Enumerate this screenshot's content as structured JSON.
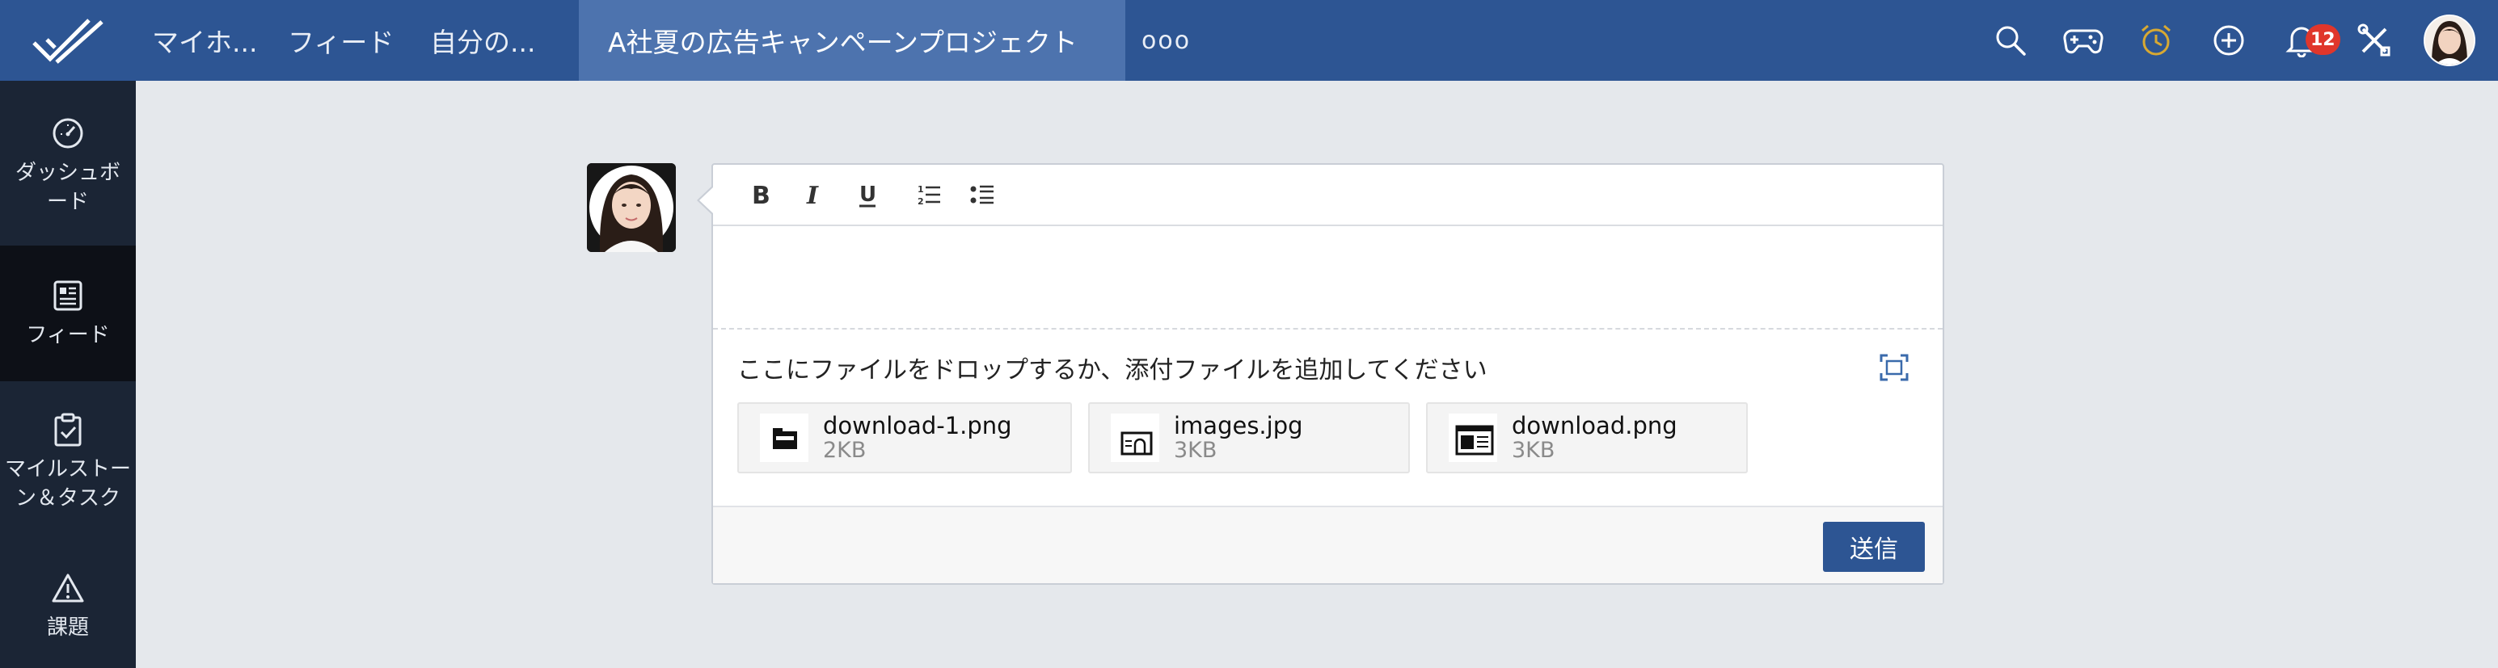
{
  "topbar": {
    "tabs": [
      {
        "label": "マイホ..."
      },
      {
        "label": "フィード"
      },
      {
        "label": "自分の..."
      },
      {
        "label": "A社夏の広告キャンペーンプロジェクト"
      }
    ],
    "more_label": "ooo",
    "notification_count": "12",
    "icons": [
      "search-icon",
      "game-controller-icon",
      "alarm-clock-icon",
      "add-icon",
      "bell-icon",
      "tools-icon"
    ]
  },
  "sidebar": {
    "items": [
      {
        "label": "ダッシュボード",
        "icon": "dashboard-gauge-icon"
      },
      {
        "label": "フィード",
        "icon": "feed-icon"
      },
      {
        "label": "マイルストーン＆タスク",
        "icon": "clipboard-check-icon"
      },
      {
        "label": "課題",
        "icon": "warning-icon"
      }
    ]
  },
  "composer": {
    "toolbar": [
      "B",
      "I",
      "U",
      "ordered-list",
      "bullet-list"
    ],
    "editor_value": "",
    "drop_text": "ここにファイルをドロップするか、添付ファイルを追加してください",
    "files": [
      {
        "name": "download-1.png",
        "size": "2KB"
      },
      {
        "name": "images.jpg",
        "size": "3KB"
      },
      {
        "name": "download.png",
        "size": "3KB"
      }
    ],
    "send_label": "送信"
  },
  "colors": {
    "topbar": "#2d5593",
    "active_tab": "#4d73ae",
    "sidebar": "#1b2535",
    "sidebar_active": "#0d1017",
    "badge": "#e0362b",
    "alarm_icon": "#d8a932",
    "send_button": "#2d5593"
  }
}
